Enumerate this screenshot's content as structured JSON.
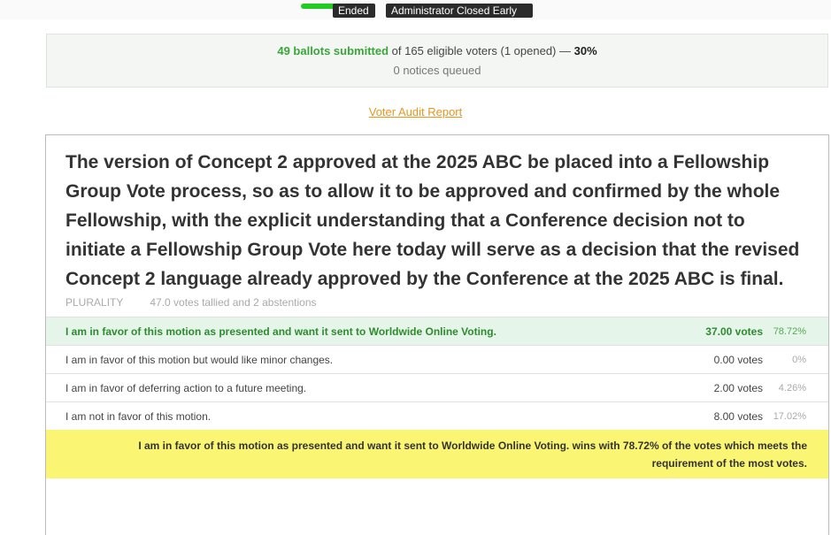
{
  "status": {
    "tags": [
      "Ended",
      "Administrator Closed Early"
    ],
    "accent_color": "#22cc22"
  },
  "summary": {
    "ballots": "49 ballots submitted",
    "eligible": " of 165 eligible voters (1 opened) — ",
    "percent": "30%",
    "notices": "0 notices queued"
  },
  "audit_link": "Voter Audit Report",
  "motion": {
    "text": "The version of Concept 2 approved at the 2025 ABC be placed into a Fellowship Group Vote process, so as to allow it to be approved and confirmed by the whole Fellowship, with the explicit understanding that a Conference decision not to initiate a Fellowship Group Vote here today will serve as a decision that the revised Concept 2 language already approved by the Conference at the 2025 ABC is final.",
    "method": "PLURALITY",
    "tally": "47.0 votes tallied and 2 abstentions"
  },
  "options": [
    {
      "label": "I am in favor of this motion as presented and want it sent to Worldwide Online Voting.",
      "votes": "37.00 votes",
      "percent": "78.72%"
    },
    {
      "label": "I am in favor of this motion but would like minor changes.",
      "votes": "0.00 votes",
      "percent": "0%"
    },
    {
      "label": "I am in favor of deferring action to a future meeting.",
      "votes": "2.00 votes",
      "percent": "4.26%"
    },
    {
      "label": "I am not in favor of this motion.",
      "votes": "8.00 votes",
      "percent": "17.02%"
    }
  ],
  "result": "I am in favor of this motion as presented and want it sent to Worldwide Online Voting. wins with 78.72% of the votes which meets the requirement of the most votes."
}
